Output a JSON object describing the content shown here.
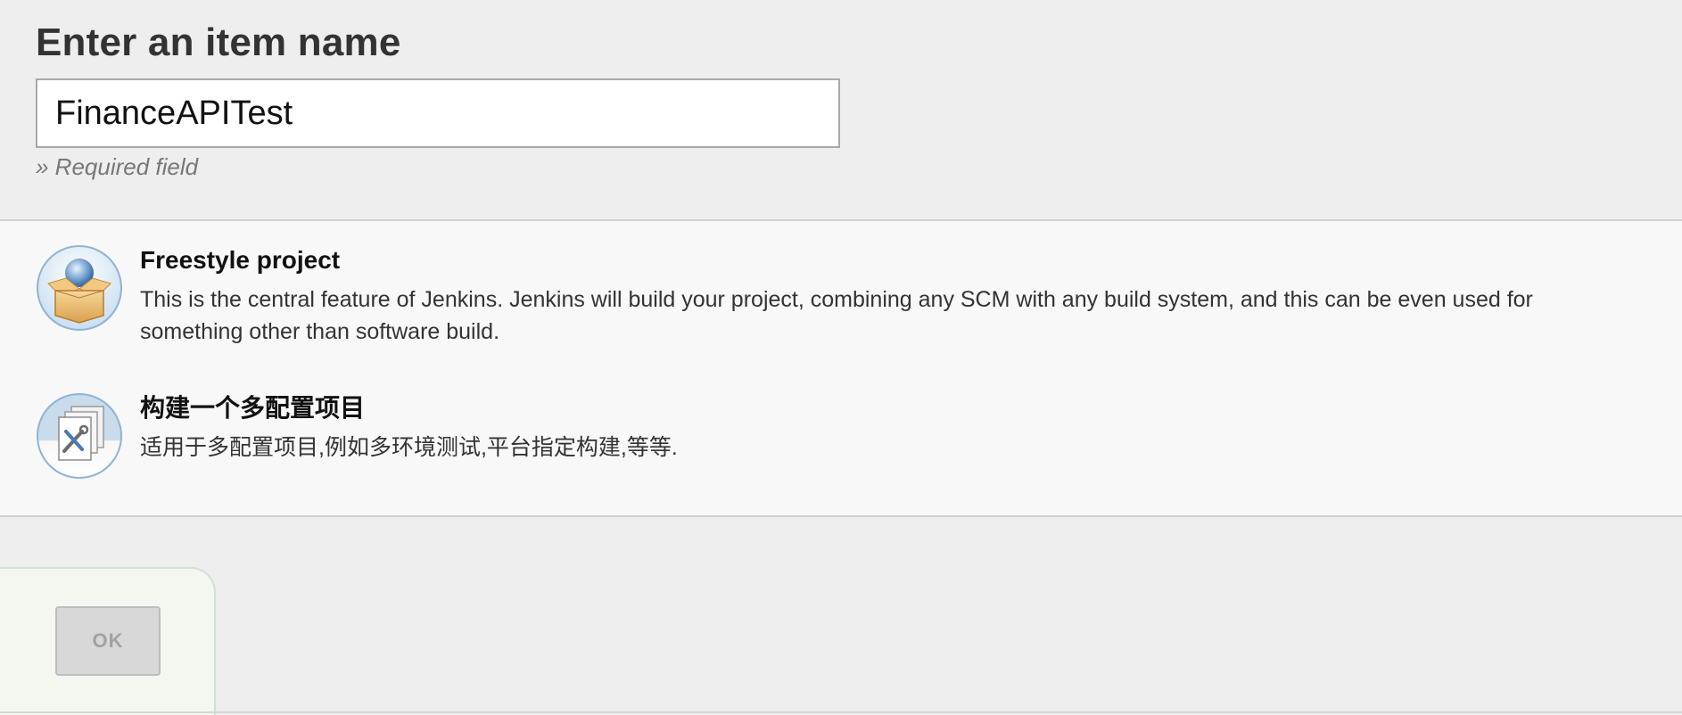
{
  "form": {
    "title": "Enter an item name",
    "item_name_value": "FinanceAPITest",
    "required_hint": "» Required field"
  },
  "item_types": [
    {
      "label": "Freestyle project",
      "description": "This is the central feature of Jenkins. Jenkins will build your project, combining any SCM with any build system, and this can be even used for something other than software build.",
      "icon": "freestyle-project-icon"
    },
    {
      "label": "构建一个多配置项目",
      "description": "适用于多配置项目,例如多环境测试,平台指定构建,等等.",
      "icon": "multi-configuration-project-icon"
    }
  ],
  "actions": {
    "ok_label": "OK",
    "ok_enabled": false
  }
}
